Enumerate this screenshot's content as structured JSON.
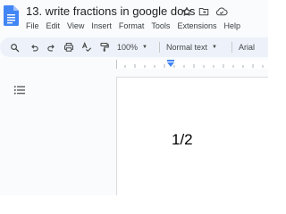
{
  "doc": {
    "title": "13. write fractions in google docs",
    "body_text": "1/2"
  },
  "menu": {
    "items": [
      "File",
      "Edit",
      "View",
      "Insert",
      "Format",
      "Tools",
      "Extensions",
      "Help"
    ]
  },
  "toolbar": {
    "zoom": "100%",
    "style": "Normal text",
    "font": "Arial"
  },
  "colors": {
    "docs_blue": "#4285f4",
    "toolbar_bg": "#edf2fa",
    "ruler_marker": "#4285f4"
  },
  "icons": [
    "docs-logo-icon",
    "star-icon",
    "move-to-folder-icon",
    "cloud-saved-icon",
    "search-icon",
    "undo-icon",
    "redo-icon",
    "print-icon",
    "spellcheck-icon",
    "paint-format-icon",
    "document-outline-icon"
  ]
}
